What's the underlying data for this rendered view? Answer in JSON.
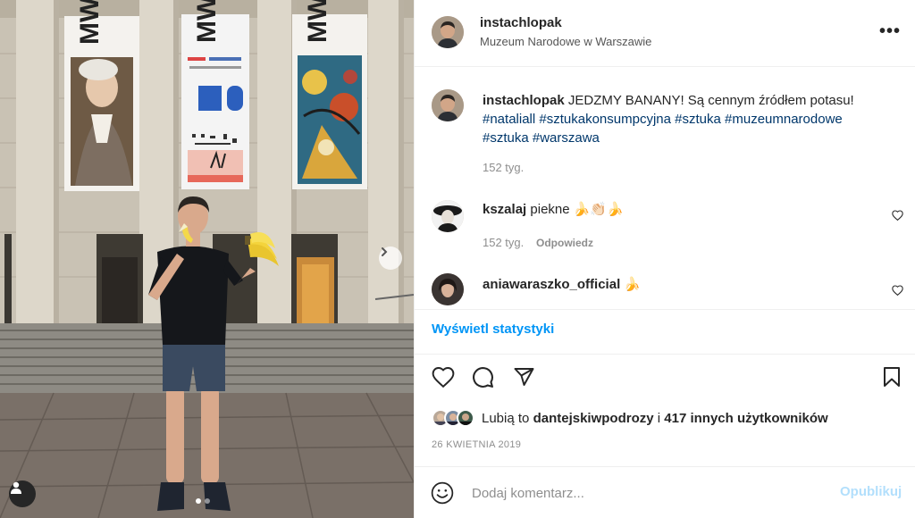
{
  "photo": {
    "next_icon": "chevron-right-icon",
    "tag_icon": "person-icon",
    "carousel_count": 2,
    "carousel_active": 1
  },
  "header": {
    "username": "instachlopak",
    "location": "Muzeum Narodowe w Warszawie",
    "more_icon": "more-horizontal-icon",
    "more_label": "•••"
  },
  "caption": {
    "username": "instachlopak",
    "text": "JEDZMY BANANY! Są cennym źródłem potasu!",
    "hashtags": [
      "#nataliall",
      "#sztukakonsumpcyjna",
      "#sztuka",
      "#muzeumnarodowe",
      "#sztuka",
      "#warszawa"
    ],
    "time": "152 tyg."
  },
  "comments": [
    {
      "username": "kszalaj",
      "text": "piekne 🍌👏🏻🍌",
      "time": "152 tyg.",
      "reply_label": "Odpowiedz"
    },
    {
      "username": "aniawaraszko_official",
      "text": "🍌"
    }
  ],
  "stats_link": "Wyświetl statystyki",
  "likes": {
    "prefix": "Lubią to",
    "user": "dantejskiwpodrozy",
    "join": "i",
    "others": "417 innych użytkowników"
  },
  "date": "26 KWIETNIA 2019",
  "add_comment": {
    "placeholder": "Dodaj komentarz...",
    "post_label": "Opublikuj"
  },
  "colors": {
    "accent": "#0095f6",
    "hashtag": "#00376b",
    "muted": "#8e8e8e"
  }
}
